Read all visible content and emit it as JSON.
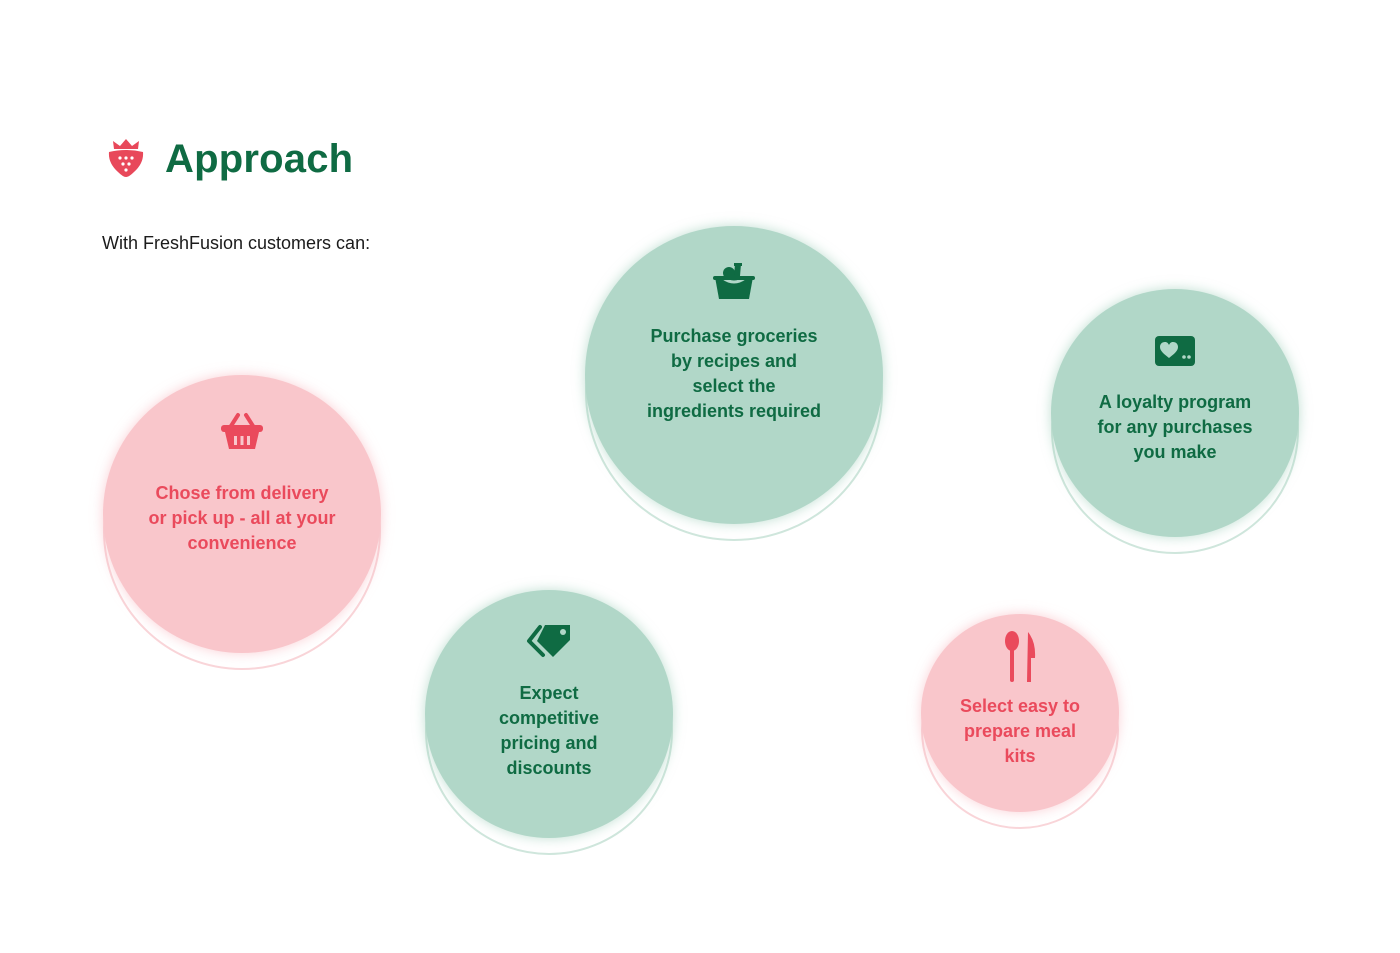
{
  "header": {
    "title": "Approach",
    "logo_icon": "strawberry-icon"
  },
  "intro": "With FreshFusion customers can:",
  "colors": {
    "green_text": "#0f6b43",
    "green_bubble": "#b1d7c8",
    "pink_text": "#ea4a5c",
    "pink_bubble": "#f9c6cb",
    "logo": "#e8485a"
  },
  "features": [
    {
      "label": "Chose from delivery or pick up - all at your convenience",
      "icon": "shopping-basket-icon",
      "theme": "pink"
    },
    {
      "label": "Purchase groceries by recipes and select the ingredients required",
      "icon": "grocery-bag-icon",
      "theme": "green"
    },
    {
      "label": "A loyalty program for any purchases you make",
      "icon": "loyalty-card-icon",
      "theme": "green"
    },
    {
      "label": "Expect competitive pricing and discounts",
      "icon": "price-tags-icon",
      "theme": "green"
    },
    {
      "label": "Select easy to prepare meal kits",
      "icon": "spoon-knife-icon",
      "theme": "pink"
    }
  ]
}
